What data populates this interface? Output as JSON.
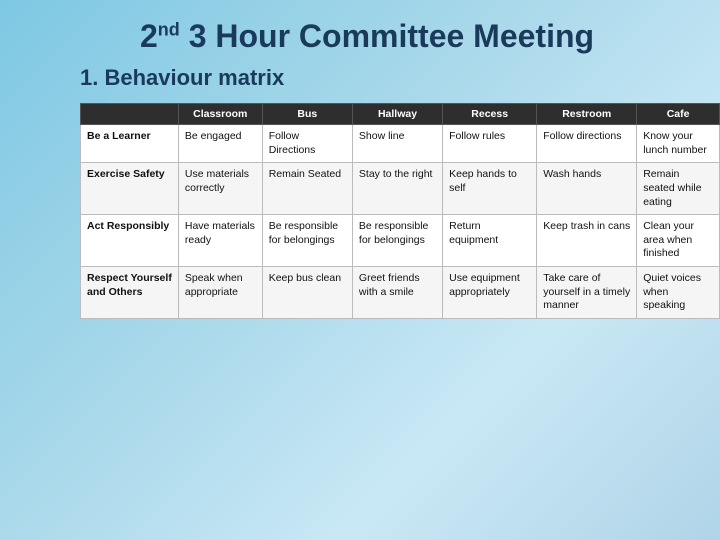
{
  "title": {
    "main": "3 Hour Committee Meeting",
    "superscript": "nd",
    "number": "2"
  },
  "subtitle": "1.   Behaviour matrix",
  "table": {
    "headers": [
      "",
      "Classroom",
      "Bus",
      "Hallway",
      "Recess",
      "Restroom",
      "Cafe"
    ],
    "rows": [
      {
        "row_header": "Be a Learner",
        "cells": [
          "Be engaged",
          "Follow Directions",
          "Show line",
          "Follow rules",
          "Follow directions",
          "Know your lunch number"
        ]
      },
      {
        "row_header": "Exercise Safety",
        "cells": [
          "Use materials correctly",
          "Remain Seated",
          "Stay to the right",
          "Keep hands to self",
          "Wash hands",
          "Remain seated while eating"
        ]
      },
      {
        "row_header": "Act Responsibly",
        "cells": [
          "Have materials ready",
          "Be responsible for belongings",
          "Be responsible for belongings",
          "Return equipment",
          "Keep trash in cans",
          "Clean your area when finished"
        ]
      },
      {
        "row_header": "Respect Yourself and Others",
        "cells": [
          "Speak when appropriate",
          "Keep bus clean",
          "Greet friends with a smile",
          "Use equipment appropriately",
          "Take care of yourself in a timely manner",
          "Quiet voices when speaking"
        ]
      }
    ]
  }
}
